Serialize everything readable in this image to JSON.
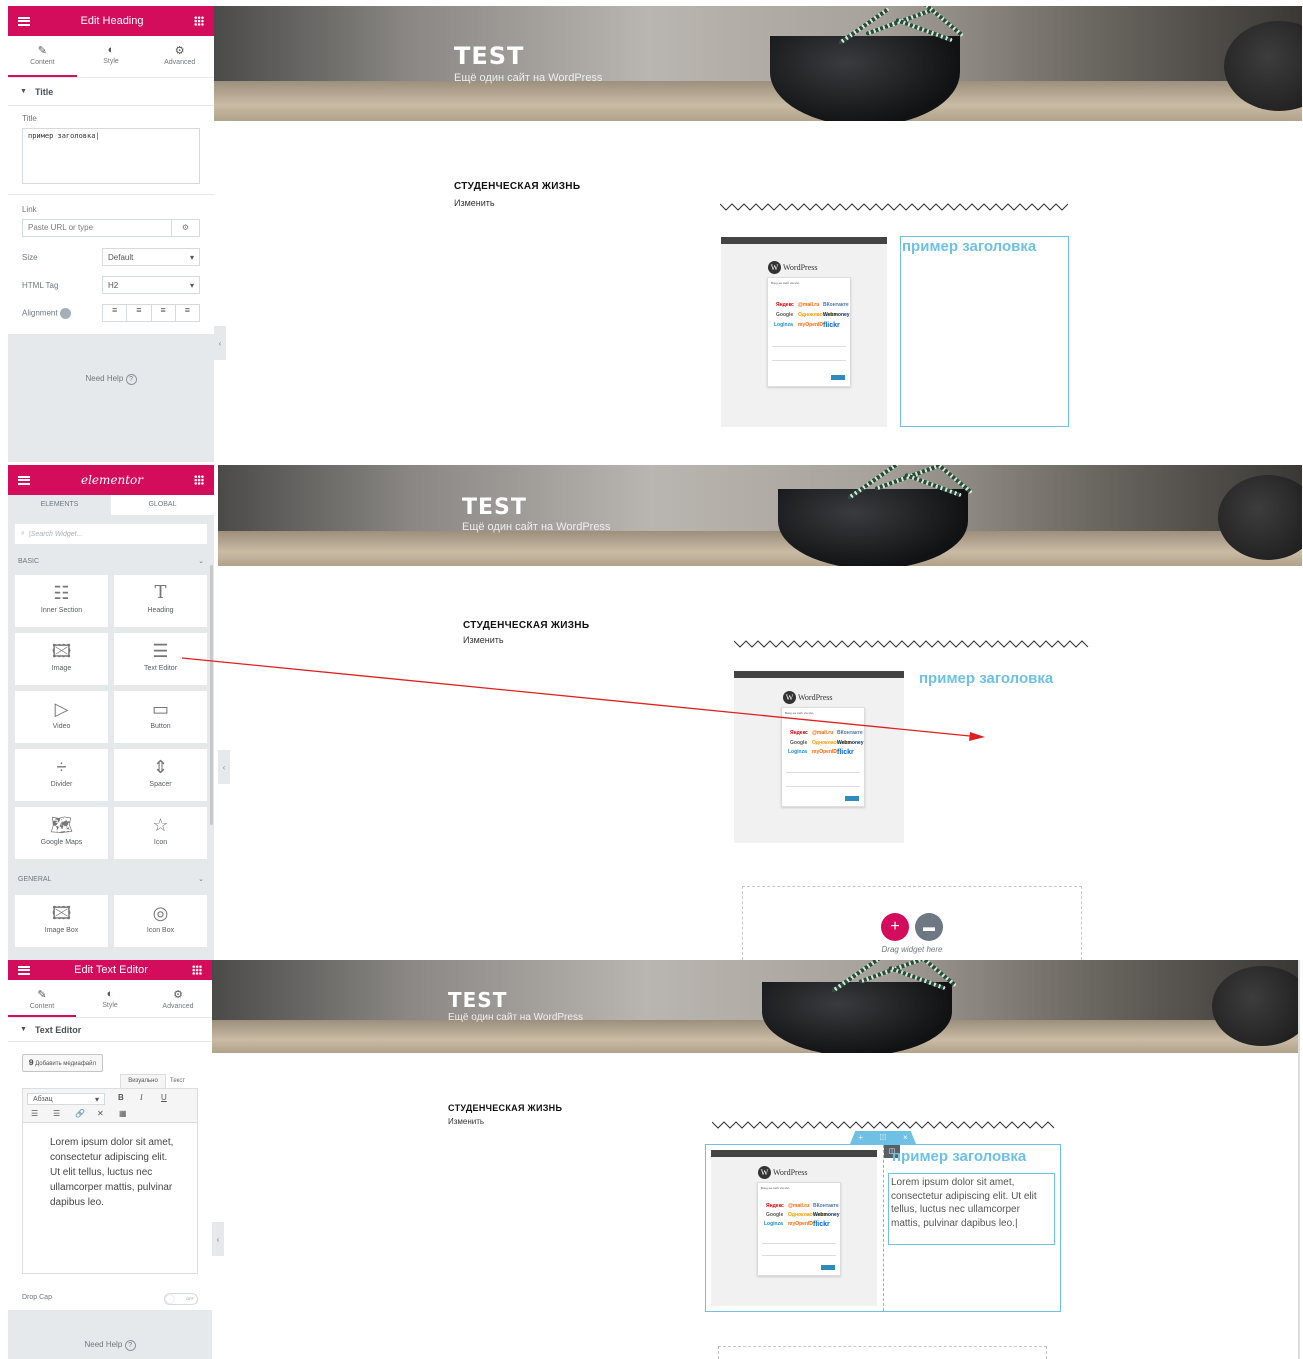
{
  "panel1": {
    "header": "Edit Heading",
    "tabs": [
      "Content",
      "Style",
      "Advanced"
    ],
    "section": "Title",
    "title_label": "Title",
    "title_value": "пример заголовка",
    "link_label": "Link",
    "link_placeholder": "Paste URL or type",
    "size_label": "Size",
    "size_value": "Default",
    "htmltag_label": "HTML Tag",
    "htmltag_value": "H2",
    "alignment_label": "Alignment",
    "need_help": "Need Help"
  },
  "panel2": {
    "logo": "elementor",
    "tab_elements": "ELEMENTS",
    "tab_global": "GLOBAL",
    "search_placeholder": "Search Widget...",
    "basic": "BASIC",
    "general": "GENERAL",
    "widgets": [
      "Inner Section",
      "Heading",
      "Image",
      "Text Editor",
      "Video",
      "Button",
      "Divider",
      "Spacer",
      "Google Maps",
      "Icon"
    ],
    "general_widgets": [
      "Image Box",
      "Icon Box"
    ]
  },
  "panel3": {
    "header": "Edit Text Editor",
    "tabs": [
      "Content",
      "Style",
      "Advanced"
    ],
    "section": "Text Editor",
    "add_media": "Добавить медиафайл",
    "tab_visual": "Визуально",
    "tab_text": "Текст",
    "format": "Абзац",
    "bold": "B",
    "italic": "I",
    "underline": "U",
    "editor_text": "Lorem ipsum dolor sit amet, consectetur adipiscing elit. Ut elit tellus, luctus nec ullamcorper mattis, pulvinar dapibus leo.",
    "drop_cap": "Drop Cap",
    "off": "OFF",
    "need_help": "Need Help"
  },
  "site": {
    "title": "TEST",
    "tagline": "Ещё один сайт на WordPress",
    "student": "СТУДЕНЧЕСКАЯ ЖИЗНЬ",
    "edit": "Изменить",
    "heading": "пример заголовка",
    "wp": "WordPress",
    "login_title": "Вход на сайт via.sho",
    "canvas3_text": "Lorem ipsum dolor sit amet, consectetur adipiscing elit. Ut elit tellus, luctus nec ullamcorper mattis, pulvinar dapibus leo.",
    "drag_widget": "Drag widget here"
  },
  "services": [
    "Яндекс",
    "@mail.ru",
    "ВКонтакте",
    "Google",
    "Одноклассники",
    "Webmoney",
    "Loginza",
    "myOpenID",
    "flickr"
  ],
  "colors": {
    "accent": "#d30c5c",
    "heading": "#6ec1e4",
    "arrow": "#e02020"
  }
}
